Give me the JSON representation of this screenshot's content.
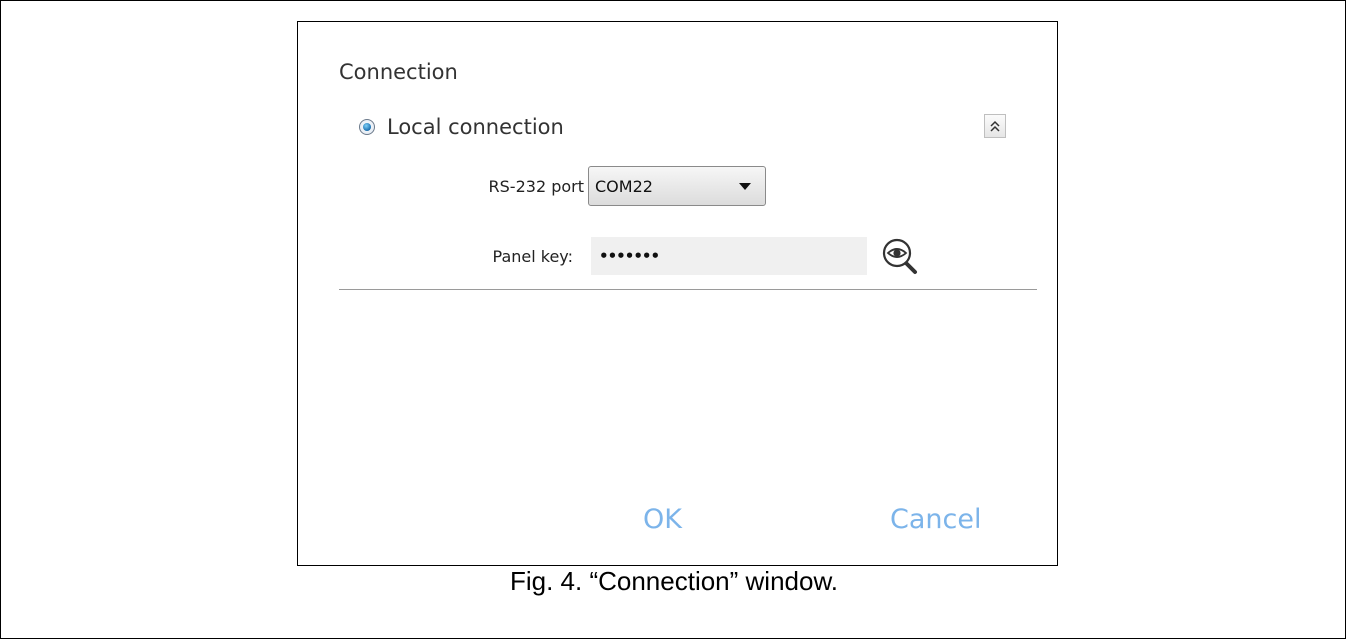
{
  "dialog": {
    "title": "Connection",
    "local_connection_label": "Local connection",
    "local_connection_selected": true,
    "collapse_icon": "double-chevron-up-icon",
    "rs232": {
      "label": "RS-232 port",
      "selected_value": "COM22"
    },
    "panel_key": {
      "label": "Panel key:",
      "value": "•••••••",
      "show_icon": "eye-magnifier-icon"
    },
    "ok_label": "OK",
    "cancel_label": "Cancel",
    "accent_color": "#7cb4ea"
  },
  "caption": "Fig. 4. “Connection” window."
}
